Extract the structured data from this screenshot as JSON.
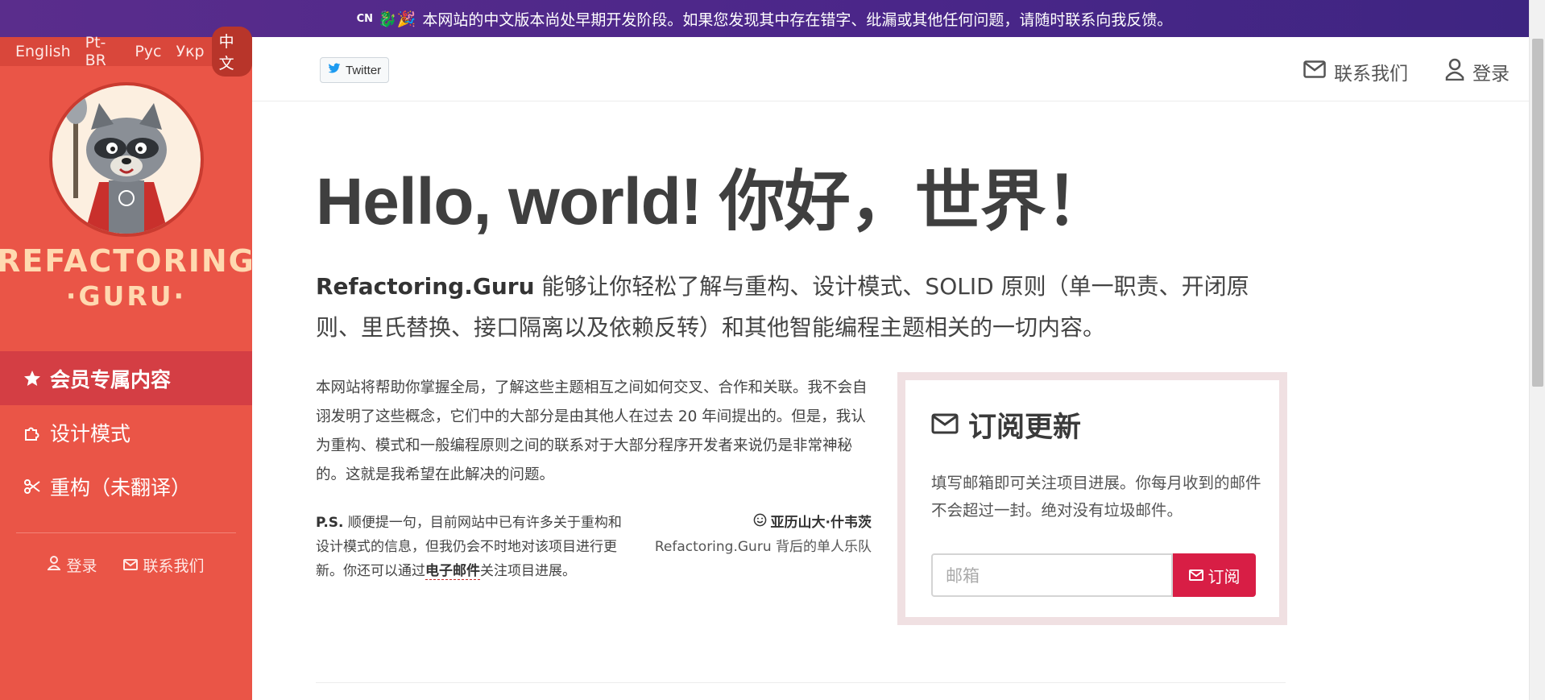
{
  "banner": {
    "flag": "CN",
    "text": "本网站的中文版本尚处早期开发阶段。如果您发现其中存在错字、纰漏或其他任何问题，请随时联系向我反馈。"
  },
  "sidebar": {
    "languages": [
      {
        "label": "English",
        "active": false
      },
      {
        "label": "Pt-BR",
        "active": false
      },
      {
        "label": "Рус",
        "active": false
      },
      {
        "label": "Укр",
        "active": false
      },
      {
        "label": "中文",
        "active": true
      }
    ],
    "logo": {
      "line1": "REFACTORING",
      "line2": "·GURU·"
    },
    "nav": [
      {
        "label": "会员专属内容",
        "icon": "star-icon",
        "active": true
      },
      {
        "label": "设计模式",
        "icon": "puzzle-icon",
        "active": false
      },
      {
        "label": "重构（未翻译）",
        "icon": "scissors-icon",
        "active": false
      }
    ],
    "bottom_links": {
      "login": "登录",
      "contact": "联系我们"
    }
  },
  "header": {
    "twitter": "Twitter",
    "contact": "联系我们",
    "login": "登录"
  },
  "main": {
    "title": "Hello, world! 你好，世界！",
    "lead_brand": "Refactoring.Guru",
    "lead_text": " 能够让你轻松了解与重构、设计模式、SOLID 原则（单一职责、开闭原则、里氏替换、接口隔离以及依赖反转）和其他智能编程主题相关的一切内容。",
    "intro": "本网站将帮助你掌握全局，了解这些主题相互之间如何交叉、合作和关联。我不会自诩发明了这些概念，它们中的大部分是由其他人在过去 20 年间提出的。但是，我认为重构、模式和一般编程原则之间的联系对于大部分程序开发者来说仍是非常神秘的。这就是我希望在此解决的问题。",
    "ps_label": "P.S.",
    "ps_text": " 顺便提一句，目前网站中已有许多关于重构和设计模式的信息，但我仍会不时地对该项目进行更新。你还可以通过",
    "ps_link": "电子邮件",
    "ps_tail": "关注项目进展。",
    "author_name": "亚历山大·什韦茨",
    "author_role": "Refactoring.Guru 背后的单人乐队"
  },
  "subscribe": {
    "title": "订阅更新",
    "description": "填写邮箱即可关注项目进展。你每月收到的邮件不会超过一封。绝对没有垃圾邮件。",
    "placeholder": "邮箱",
    "button": "订阅"
  },
  "colors": {
    "sidebar": "#ea5547",
    "sidebar_active": "#d43e44",
    "banner": "#4a2689",
    "subscribe_button": "#d81e45"
  }
}
